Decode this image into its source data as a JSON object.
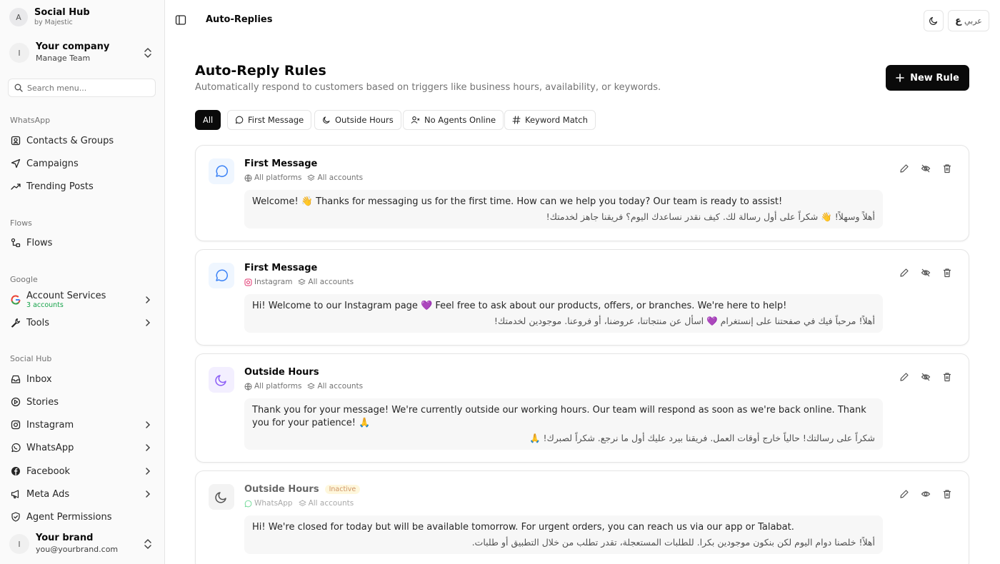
{
  "sidebar": {
    "brand": {
      "avatar": "A",
      "name": "Social Hub",
      "sub": "by Majestic"
    },
    "team": {
      "avatar": "I",
      "name": "Your company",
      "sub": "Manage Team"
    },
    "search_placeholder": "Search menu...",
    "groups": {
      "whatsapp": "WhatsApp",
      "flows": "Flows",
      "google": "Google",
      "social_hub": "Social Hub"
    },
    "items": {
      "contacts": "Contacts & Groups",
      "campaigns": "Campaigns",
      "trending": "Trending Posts",
      "flows": "Flows",
      "account_services": "Account Services",
      "account_services_sub": "3 accounts",
      "tools": "Tools",
      "inbox": "Inbox",
      "stories": "Stories",
      "instagram": "Instagram",
      "whatsapp": "WhatsApp",
      "facebook": "Facebook",
      "meta_ads": "Meta Ads",
      "agent_permissions": "Agent Permissions"
    },
    "user": {
      "avatar": "I",
      "name": "Your brand",
      "email": "you@yourbrand.com"
    }
  },
  "header": {
    "breadcrumb": "Auto-Replies",
    "lang_label": "عربي",
    "lang_glyph": "ع"
  },
  "main": {
    "title": "Auto-Reply Rules",
    "subtitle": "Automatically respond to customers based on triggers like business hours, availability, or keywords.",
    "new_rule_label": "New Rule",
    "filters": [
      "All",
      "First Message",
      "Outside Hours",
      "No Agents Online",
      "Keyword Match"
    ],
    "active_filter": "All",
    "rules": [
      {
        "title": "First Message",
        "platform": "All platforms",
        "accounts": "All accounts",
        "text_en": "Welcome! 👋 Thanks for messaging us for the first time. How can we help you today? Our team is ready to assist!",
        "text_ar": "أهلاً وسهلاً! 👋 شكراً على أول رسالة لك. كيف نقدر نساعدك اليوم؟ فريقنا جاهز لخدمتك!",
        "active": true
      },
      {
        "title": "First Message",
        "platform": "Instagram",
        "accounts": "All accounts",
        "text_en": "Hi! Welcome to our Instagram page 💜 Feel free to ask about our products, offers, or branches. We're here to help!",
        "text_ar": "أهلاً! مرحباً فيك في صفحتنا على إنستغرام 💜 اسأل عن منتجاتنا، عروضنا، أو فروعنا. موجودين لخدمتك!",
        "active": true
      },
      {
        "title": "Outside Hours",
        "platform": "All platforms",
        "accounts": "All accounts",
        "text_en": "Thank you for your message! We're currently outside our working hours. Our team will respond as soon as we're back online. Thank you for your patience! 🙏",
        "text_ar": "شكراً على رسالتك! حالياً خارج أوقات العمل. فريقنا بيرد عليك أول ما نرجع. شكراً لصبرك! 🙏",
        "active": true
      },
      {
        "title": "Outside Hours",
        "badge": "Inactive",
        "platform": "WhatsApp",
        "accounts": "All accounts",
        "text_en": "Hi! We're closed for today but will be available tomorrow. For urgent orders, you can reach us via our app or Talabat.",
        "text_ar": "أهلاً! خلصنا دوام اليوم لكن بنكون موجودين بكرا. للطلبات المستعجلة، تقدر تطلب من خلال التطبيق أو طلبات.",
        "active": false
      }
    ]
  },
  "colors": {
    "accent": "#0a0a0a",
    "first_message_icon": "#3b82f6",
    "outside_hours_icon": "#8b5cf6",
    "inactive_badge": "#b45309",
    "google_green": "#16a34a",
    "whatsapp_green": "#22c55e",
    "instagram_pink": "#e1306c"
  }
}
